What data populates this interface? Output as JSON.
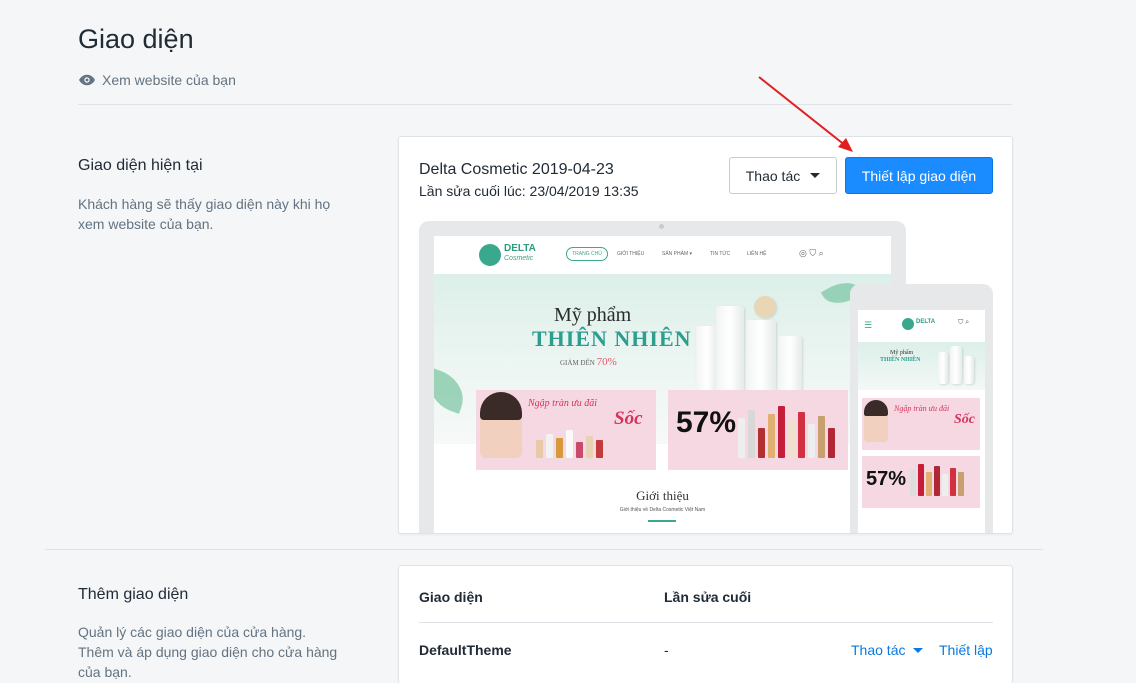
{
  "page": {
    "title": "Giao diện",
    "view_site_label": "Xem website của bạn"
  },
  "current_theme_section": {
    "title": "Giao diện hiện tại",
    "description": "Khách hàng sẽ thấy giao diện này khi họ xem website của bạn.",
    "theme_name": "Delta Cosmetic 2019-04-23",
    "last_edited": "Lần sửa cuối lúc: 23/04/2019 13:35",
    "actions_button": "Thao tác",
    "customize_button": "Thiết lập giao diện"
  },
  "preview": {
    "logo_main": "DELTA",
    "logo_sub": "Cosmetic",
    "nav_items": [
      "TRANG CHỦ",
      "GIỚI THIỆU",
      "SẢN PHẨM ▾",
      "TIN TỨC",
      "LIÊN HỆ"
    ],
    "hero_line1": "Mỹ phẩm",
    "hero_line2": "THIÊN NHIÊN",
    "hero_discount_label": "GIẢM ĐẾN",
    "hero_discount_value": "70%",
    "promo1_title": "Ngập tràn ưu đãi",
    "promo1_big": "Sốc",
    "promo2_big": "57%",
    "intro_title": "Giới thiệu",
    "intro_sub": "Giới thiệu về Delta Cosmetic Việt Nam"
  },
  "add_theme_section": {
    "title": "Thêm giao diện",
    "description_1": "Quản lý các giao diện của cửa hàng.",
    "description_2": "Thêm và áp dụng giao diện cho cửa hàng của bạn.",
    "table": {
      "headers": [
        "Giao diện",
        "Lần sửa cuối"
      ],
      "rows": [
        {
          "name": "DefaultTheme",
          "last_edited": "-",
          "actions_label": "Thao tác",
          "setup_label": "Thiết lập"
        }
      ]
    }
  },
  "colors": {
    "primary": "#1a8cff",
    "link": "#0a79e0",
    "annotation_arrow": "#e02020"
  }
}
